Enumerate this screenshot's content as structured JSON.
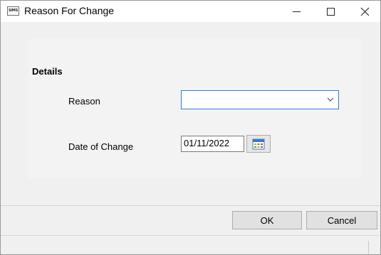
{
  "window": {
    "title": "Reason For Change",
    "app_icon_text": "SIMS",
    "icons": {
      "minimize": "minimize-icon",
      "maximize": "maximize-icon",
      "close": "close-icon"
    }
  },
  "details": {
    "heading": "Details",
    "reason": {
      "label": "Reason",
      "selected_value": ""
    },
    "date_of_change": {
      "label": "Date of Change",
      "value": "01/11/2022",
      "button_icon": "calendar-icon"
    }
  },
  "footer": {
    "ok_label": "OK",
    "cancel_label": "Cancel"
  },
  "colors": {
    "accent": "#2f7cd6",
    "window_bg": "#f0f0f0"
  }
}
